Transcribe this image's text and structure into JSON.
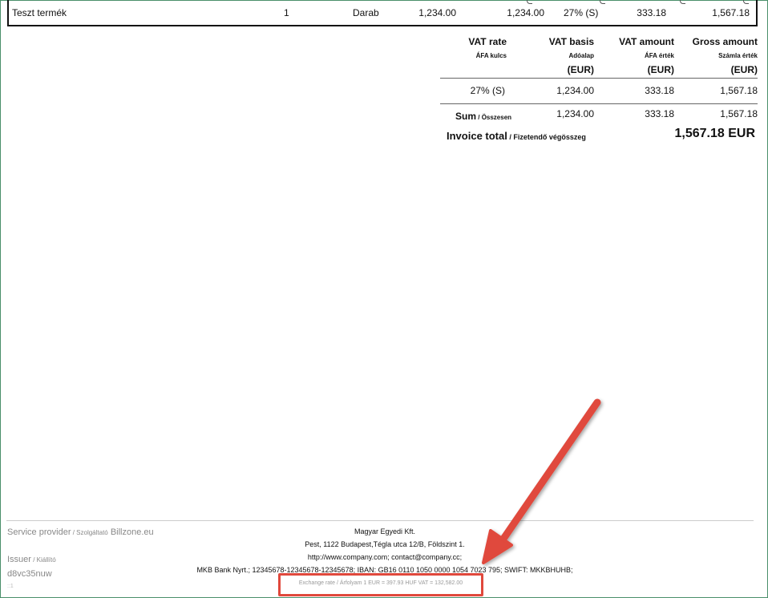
{
  "item": {
    "name": "Teszt termék",
    "quantity": "1",
    "unit": "Darab",
    "unit_price": "1,234.00",
    "net_amount": "1,234.00",
    "vat_rate": "27% (S)",
    "vat_amount": "333.18",
    "gross_amount": "1,567.18"
  },
  "vat_summary": {
    "headers": [
      {
        "en": "VAT rate",
        "hu": "ÁFA kulcs",
        "unit": ""
      },
      {
        "en": "VAT basis",
        "hu": "Adóalap",
        "unit": "(EUR)"
      },
      {
        "en": "VAT amount",
        "hu": "ÁFA érték",
        "unit": "(EUR)"
      },
      {
        "en": "Gross amount",
        "hu": "Számla érték",
        "unit": "(EUR)"
      }
    ],
    "row": {
      "rate": "27% (S)",
      "basis": "1,234.00",
      "vat": "333.18",
      "gross": "1,567.18"
    },
    "sum": {
      "label_en": "Sum",
      "label_hu": "Összesen",
      "basis": "1,234.00",
      "vat": "333.18",
      "gross": "1,567.18"
    },
    "total": {
      "label_en": "Invoice total",
      "label_hu": "Fizetendő végösszeg",
      "value": "1,567.18 EUR"
    }
  },
  "footer": {
    "service_provider_label": "Service provider",
    "service_provider_hu": "Szolgáltató",
    "service_provider_name": "Billzone.eu",
    "issuer_label": "Issuer",
    "issuer_hu": "Kiállító",
    "issuer_value": "d8vc35nuw",
    "page_marker": "::1",
    "company_name": "Magyar Egyedi Kft.",
    "address": "Pest, 1122 Budapest,Tégla utca 12/B, Földszint 1.",
    "web_contact": "http://www.company.com; contact@company.cc;",
    "bank": "MKB Bank Nyrt.; 12345678-12345678-12345678; IBAN: GB16 0110 1050 0000 1054 7023 795; SWIFT: MKKBHUHB;",
    "exchange_rate": "Exchange rate / Árfolyam   1 EUR = 397.93 HUF   VAT = 132,582.00"
  },
  "colors": {
    "annotation": "#e0483c",
    "frame": "#4a8f6a"
  }
}
